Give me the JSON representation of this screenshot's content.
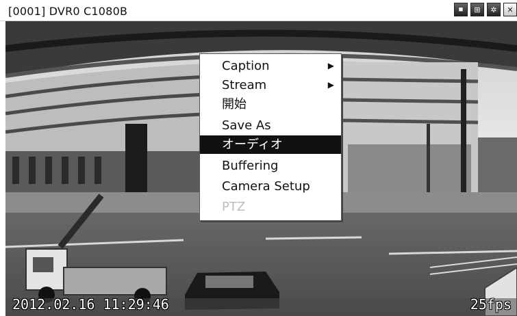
{
  "window": {
    "title": "[0001] DVR0 C1080B",
    "buttons": [
      {
        "name": "stop-icon",
        "glyph": "■"
      },
      {
        "name": "grid-icon",
        "glyph": "⊞"
      },
      {
        "name": "settings-icon",
        "glyph": "✲"
      },
      {
        "name": "close-icon",
        "glyph": "✕"
      }
    ]
  },
  "video": {
    "timestamp": "2012.02.16 11:29:46",
    "fps": "25fps"
  },
  "context_menu": {
    "items": [
      {
        "label": "Caption",
        "submenu": true,
        "state": "normal"
      },
      {
        "label": "Stream",
        "submenu": true,
        "state": "normal"
      },
      {
        "label": "開始",
        "submenu": false,
        "state": "normal"
      },
      {
        "label": "Save As",
        "submenu": false,
        "state": "normal"
      },
      {
        "label": "オーディオ",
        "submenu": false,
        "state": "selected"
      },
      {
        "label": "Buffering",
        "submenu": false,
        "state": "normal"
      },
      {
        "label": "Camera Setup",
        "submenu": false,
        "state": "normal"
      },
      {
        "label": "PTZ",
        "submenu": false,
        "state": "disabled"
      }
    ],
    "submenu_arrow": "▶"
  }
}
